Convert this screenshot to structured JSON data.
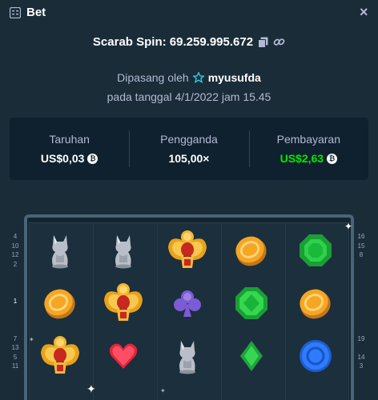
{
  "header": {
    "title": "Bet",
    "menu_icon": "bet-slip-icon",
    "close_glyph": "×"
  },
  "spin": {
    "text": "Scarab Spin: 69.259.995.672",
    "copy_icon": "copy-icon",
    "link_icon": "link-icon"
  },
  "placed_by": {
    "prefix": "Dipasang oleh",
    "username": "myusufda",
    "badge_icon": "star-badge-icon"
  },
  "date_text": "pada tanggal 4/1/2022 jam 15.45",
  "stats": [
    {
      "label": "Taruhan",
      "value": "US$0,03",
      "coin": true,
      "color": "#ffffff"
    },
    {
      "label": "Pengganda",
      "value": "105,00×",
      "coin": false,
      "color": "#ffffff"
    },
    {
      "label": "Pembayaran",
      "value": "US$2,63",
      "coin": true,
      "color": "#00e701"
    }
  ],
  "coin_glyph": "₿",
  "side_numbers": {
    "left": [
      "4",
      "10",
      "12",
      "2",
      "",
      "",
      "",
      "1",
      "",
      "",
      "",
      "7",
      "13",
      "5",
      "11"
    ],
    "right": [
      "16",
      "15",
      "8",
      "",
      "",
      "",
      "",
      "",
      "",
      "",
      "",
      "19",
      "",
      "14",
      "3"
    ],
    "highlight_left": "1"
  },
  "reels": [
    [
      "cat-statue",
      "coin",
      "scarab"
    ],
    [
      "cat-statue",
      "scarab",
      "heart"
    ],
    [
      "scarab",
      "club",
      "cat-statue"
    ],
    [
      "coin",
      "emerald-round",
      "diamond"
    ],
    [
      "emerald",
      "coin",
      "sapphire"
    ]
  ],
  "colors": {
    "background": "#1a2c38",
    "panel": "#0f212e",
    "muted": "#b1bad3",
    "win": "#00e701"
  }
}
